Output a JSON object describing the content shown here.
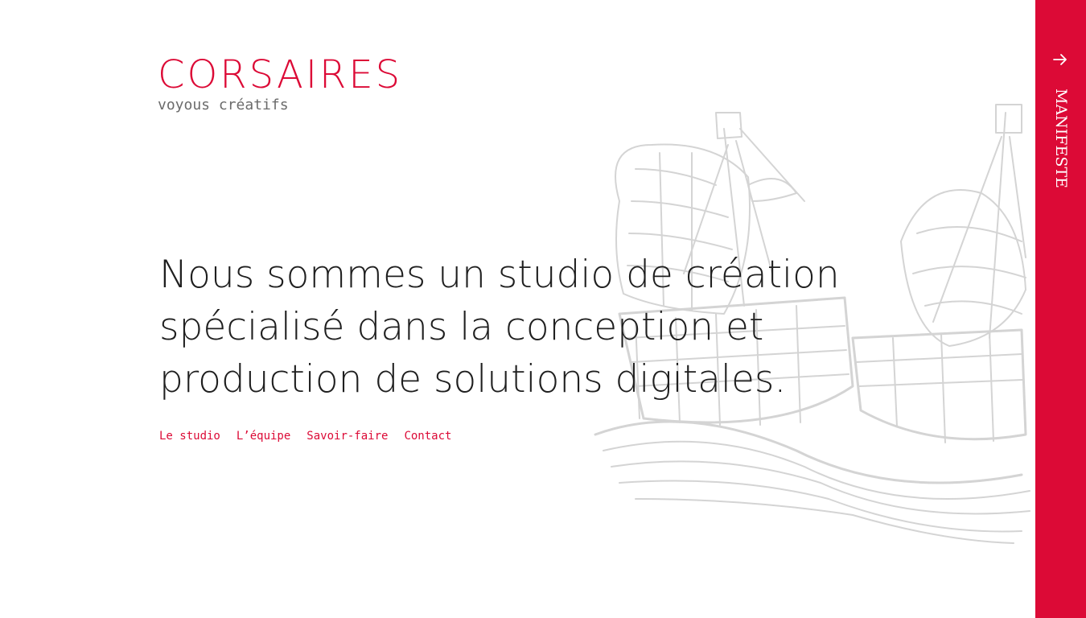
{
  "logo": {
    "wordmark": "CORSAIRES",
    "tagline": "voyous créatifs"
  },
  "headline": {
    "lines": [
      "Nous sommes un studio de création",
      "spécialisé dans la conception et",
      "production de solutions digitales."
    ]
  },
  "nav": {
    "items": [
      {
        "label": "Le studio"
      },
      {
        "label": "L’équipe"
      },
      {
        "label": "Savoir-faire"
      },
      {
        "label": "Contact"
      }
    ]
  },
  "sidebar": {
    "label": "MANIFESTE",
    "icon": "arrow-right-icon"
  },
  "colors": {
    "accent": "#dc0a36",
    "text": "#1f1f1f",
    "muted": "#6b6b6b",
    "illustration": "#d6d6d6"
  }
}
